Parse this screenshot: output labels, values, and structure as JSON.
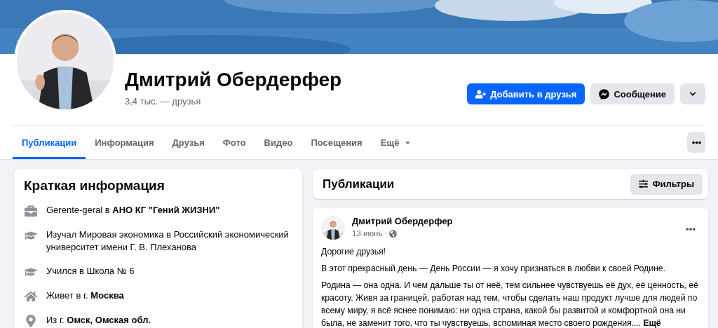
{
  "profile": {
    "name": "Дмитрий Обердерфер",
    "friends": "3,4 тыс. — друзья"
  },
  "actions": [
    {
      "kind": "add_friend",
      "label": "Добавить в друзья"
    },
    {
      "kind": "message",
      "label": "Сообщение"
    },
    {
      "kind": "more"
    }
  ],
  "tabs": [
    {
      "label": "Публикации",
      "selected": true
    },
    {
      "label": "Информация",
      "selected": false
    },
    {
      "label": "Друзья",
      "selected": false
    },
    {
      "label": "Фото",
      "selected": false
    },
    {
      "label": "Видео",
      "selected": false
    },
    {
      "label": "Посещения",
      "selected": false
    },
    {
      "label": "Ещё",
      "selected": false,
      "dropdown": true
    }
  ],
  "intro": {
    "title": "Краткая информация",
    "items": [
      {
        "kind": "work",
        "text": "Gerente-geral в **АНО КГ \"Гений ЖИЗНИ\"**"
      },
      {
        "kind": "education",
        "text": "Изучал Мировая экономика в Российский экономический университет имени Г. В. Плеханова"
      },
      {
        "kind": "education",
        "text": "Учился в Школа № 6"
      },
      {
        "kind": "home",
        "text": "Живет в г. **Москва**"
      },
      {
        "kind": "location",
        "text": "Из г. **Омск, Омская обл.**"
      }
    ]
  },
  "posts_header": {
    "title": "Публикации",
    "filter_label": "Фильтры"
  },
  "post": {
    "author": "Дмитрий Обердерфер",
    "date": "13 июнь ·",
    "public": true,
    "paragraphs": [
      "Дорогие друзья!",
      "В этот прекрасный день — День России — я хочу признаться в любви к своей Родине.",
      "Родина — она одна. И чем дальше ты от неё, тем сильнее чувствуешь её дух, её ценность, её красоту. Живя за границей, работая над тем, чтобы сделать наш продукт лучше для людей по всему миру, я всё яснее понимаю: ни одна страна, какой бы развитой и комфортной она ни была, не заменит того, что ты чувствуешь, вспоминая место своего рождения...."
    ],
    "more_label": "Ещё"
  }
}
